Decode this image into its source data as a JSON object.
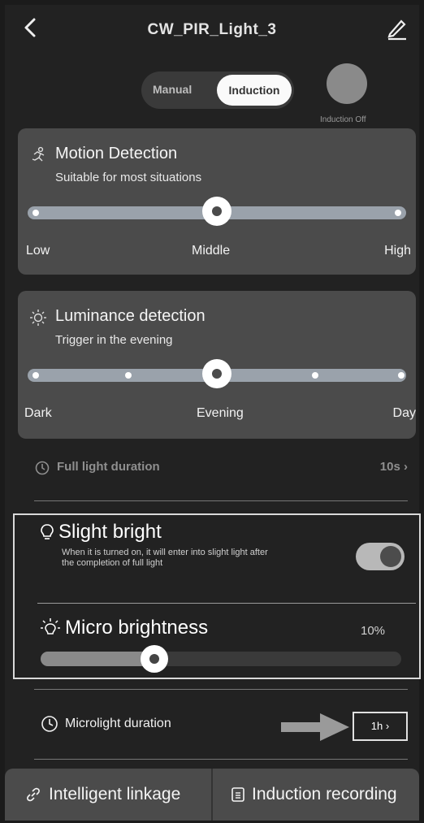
{
  "header": {
    "title": "CW_PIR_Light_3"
  },
  "mode": {
    "manual_label": "Manual",
    "induction_label": "Induction",
    "induction_off_label": "Induction Off"
  },
  "motion": {
    "title": "Motion Detection",
    "subtitle": "Suitable for most situations",
    "labels": [
      "Low",
      "Middle",
      "High"
    ],
    "level": 0.5
  },
  "luminance": {
    "title": "Luminance detection",
    "subtitle": "Trigger in the evening",
    "labels": [
      "Dark",
      "Evening",
      "Day"
    ],
    "level": 0.5
  },
  "full_light": {
    "label": "Full light duration",
    "value": "10s ›"
  },
  "slight_bright": {
    "title": "Slight bright",
    "description": "When it is turned on, it will enter into slight light after the completion of full light",
    "enabled": true
  },
  "micro_brightness": {
    "title": "Micro brightness",
    "value_label": "10%",
    "level": 0.3
  },
  "microlight": {
    "label": "Microlight duration",
    "value": "1h  ›"
  },
  "bottom": {
    "linkage_label": "Intelligent linkage",
    "recording_label": "Induction recording"
  }
}
